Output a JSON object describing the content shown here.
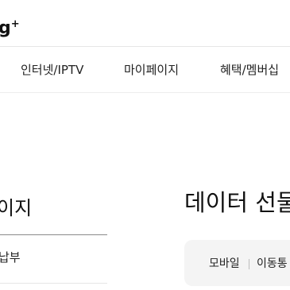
{
  "header": {
    "logo_text": "g",
    "logo_plus": "+"
  },
  "nav": {
    "items": [
      {
        "label": "인터넷/IPTV"
      },
      {
        "label": "마이페이지"
      },
      {
        "label": "혜택/멤버십"
      }
    ]
  },
  "sidebar": {
    "title": "이지",
    "items": [
      {
        "label": "납부"
      }
    ]
  },
  "main": {
    "title": "데이터 선물",
    "tabs": [
      {
        "label": "모바일"
      },
      {
        "label": "이동통"
      }
    ]
  }
}
